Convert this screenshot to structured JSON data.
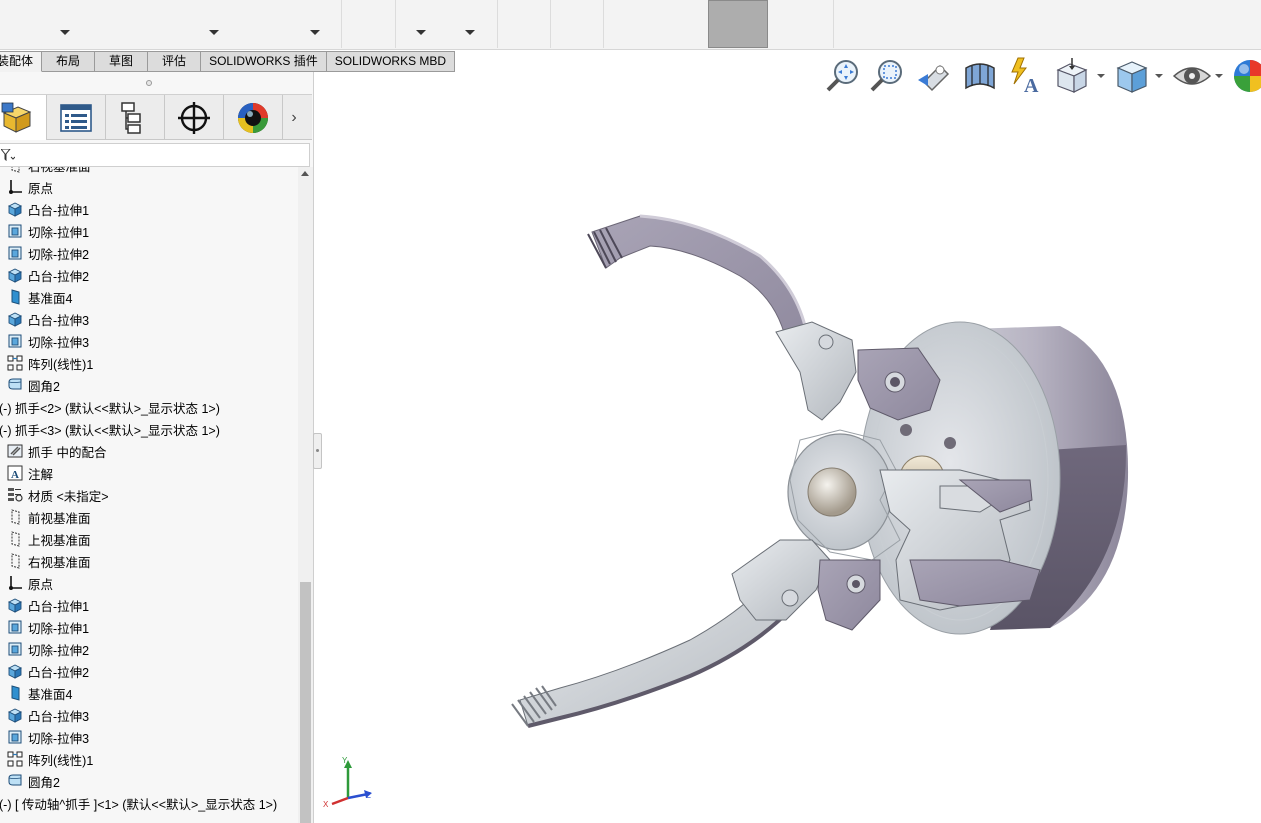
{
  "command_tabs": [
    {
      "label": "装配体",
      "active": true
    },
    {
      "label": "布局"
    },
    {
      "label": "草图"
    },
    {
      "label": "评估"
    },
    {
      "label": "SOLIDWORKS 插件"
    },
    {
      "label": "SOLIDWORKS MBD"
    }
  ],
  "panel_tabs": [
    "feature-manager-icon",
    "property-manager-icon",
    "configuration-manager-icon",
    "dimxpert-icon",
    "display-manager-icon"
  ],
  "tree": [
    {
      "label": "右视基准面",
      "icon": "plane-icon"
    },
    {
      "label": "原点",
      "icon": "origin-icon"
    },
    {
      "label": "凸台-拉伸1",
      "icon": "boss-extrude-icon"
    },
    {
      "label": "切除-拉伸1",
      "icon": "cut-extrude-icon"
    },
    {
      "label": "切除-拉伸2",
      "icon": "cut-extrude-icon"
    },
    {
      "label": "凸台-拉伸2",
      "icon": "boss-extrude-icon"
    },
    {
      "label": "基准面4",
      "icon": "plane-solid-icon"
    },
    {
      "label": "凸台-拉伸3",
      "icon": "boss-extrude-icon"
    },
    {
      "label": "切除-拉伸3",
      "icon": "cut-extrude-icon"
    },
    {
      "label": "阵列(线性)1",
      "icon": "linear-pattern-icon"
    },
    {
      "label": "圆角2",
      "icon": "fillet-icon"
    },
    {
      "label": "(-) 抓手<2> (默认<<默认>_显示状态 1>)",
      "icon": "component"
    },
    {
      "label": "(-) 抓手<3> (默认<<默认>_显示状态 1>)",
      "icon": "component"
    },
    {
      "label": "抓手 中的配合",
      "icon": "mates-icon"
    },
    {
      "label": "注解",
      "icon": "annotations-icon"
    },
    {
      "label": "材质 <未指定>",
      "icon": "material-icon"
    },
    {
      "label": "前视基准面",
      "icon": "plane-icon"
    },
    {
      "label": "上视基准面",
      "icon": "plane-icon"
    },
    {
      "label": "右视基准面",
      "icon": "plane-icon"
    },
    {
      "label": "原点",
      "icon": "origin-icon"
    },
    {
      "label": "凸台-拉伸1",
      "icon": "boss-extrude-icon"
    },
    {
      "label": "切除-拉伸1",
      "icon": "cut-extrude-icon"
    },
    {
      "label": "切除-拉伸2",
      "icon": "cut-extrude-icon"
    },
    {
      "label": "凸台-拉伸2",
      "icon": "boss-extrude-icon"
    },
    {
      "label": "基准面4",
      "icon": "plane-solid-icon"
    },
    {
      "label": "凸台-拉伸3",
      "icon": "boss-extrude-icon"
    },
    {
      "label": "切除-拉伸3",
      "icon": "cut-extrude-icon"
    },
    {
      "label": "阵列(线性)1",
      "icon": "linear-pattern-icon"
    },
    {
      "label": "圆角2",
      "icon": "fillet-icon"
    },
    {
      "label": "(-) [ 传动轴^抓手 ]<1> (默认<<默认>_显示状态 1>)",
      "icon": "component"
    }
  ],
  "heads_up_toolbar": [
    "zoom-to-fit-icon",
    "zoom-to-area-icon",
    "previous-view-icon",
    "section-view-icon",
    "dynamic-annotation-icon",
    "view-orientation-icon",
    "display-style-icon",
    "hide-show-items-icon",
    "edit-appearance-icon"
  ],
  "triad": {
    "x": "X",
    "y": "Y",
    "z": "Z"
  }
}
